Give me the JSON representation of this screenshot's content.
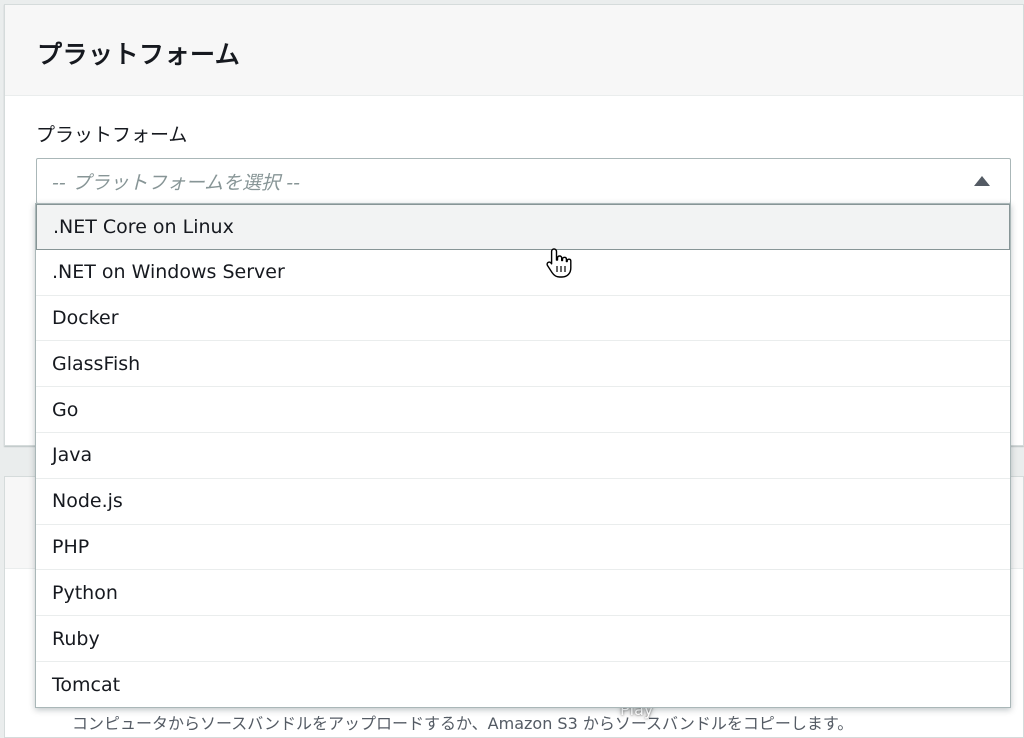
{
  "panel": {
    "title": "プラットフォーム",
    "field_label": "プラットフォーム",
    "select_placeholder": "-- プラットフォームを選択 --"
  },
  "dropdown": {
    "options": [
      ".NET Core on Linux",
      ".NET on Windows Server",
      "Docker",
      "GlassFish",
      "Go",
      "Java",
      "Node.js",
      "PHP",
      "Python",
      "Ruby",
      "Tomcat"
    ],
    "highlighted_index": 0
  },
  "source_panel": {
    "description": "コンピュータからソースバンドルをアップロードするか、Amazon S3 からソースバンドルをコピーします。"
  },
  "overlay": {
    "play_label": "Play"
  },
  "icons": {
    "caret": "caret-up-icon",
    "cursor": "hand-pointer-icon"
  }
}
